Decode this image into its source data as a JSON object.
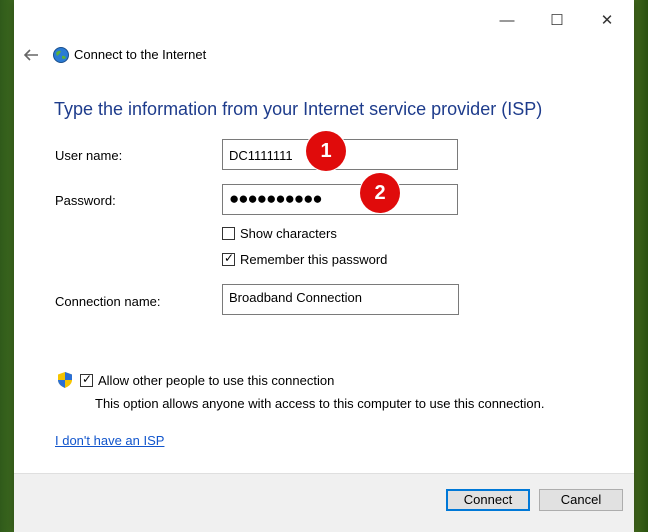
{
  "window": {
    "title": "Connect to the Internet",
    "controls": {
      "minimize": "—",
      "maximize": "☐",
      "close": "✕"
    }
  },
  "heading": "Type the information from your Internet service provider (ISP)",
  "form": {
    "username_label": "User name:",
    "username_value": "DC1111111",
    "password_label": "Password:",
    "password_value": "●●●●●●●●●●",
    "show_characters_label": "Show characters",
    "show_characters_checked": false,
    "remember_label": "Remember this password",
    "remember_checked": true,
    "connection_name_label": "Connection name:",
    "connection_name_value": "Broadband Connection"
  },
  "annotations": {
    "badge1": "1",
    "badge2": "2",
    "badge_color": "#e00b0b"
  },
  "sharing": {
    "allow_label": "Allow other people to use this connection",
    "allow_checked": true,
    "description": "This option allows anyone with access to this computer to use this connection."
  },
  "link_no_isp": "I don't have an ISP",
  "buttons": {
    "connect": "Connect",
    "cancel": "Cancel"
  },
  "icons": {
    "back": "back-arrow-icon",
    "network": "globe-network-icon",
    "shield": "uac-shield-icon",
    "check": "✓"
  },
  "colors": {
    "heading": "#1e3c8c",
    "link": "#1155cc",
    "primary_border": "#0078d7"
  }
}
